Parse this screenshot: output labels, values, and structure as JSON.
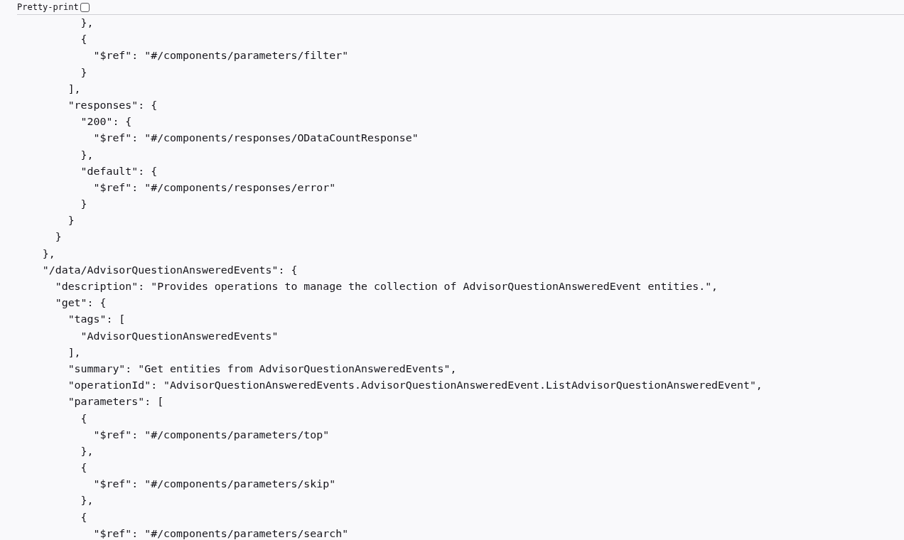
{
  "toolbar": {
    "label": "Pretty-print",
    "checked": false
  },
  "lines": [
    "            },",
    "            {",
    "              \"$ref\": \"#/components/parameters/filter\"",
    "            }",
    "          ],",
    "          \"responses\": {",
    "            \"200\": {",
    "              \"$ref\": \"#/components/responses/ODataCountResponse\"",
    "            },",
    "            \"default\": {",
    "              \"$ref\": \"#/components/responses/error\"",
    "            }",
    "          }",
    "        }",
    "      },",
    "      \"/data/AdvisorQuestionAnsweredEvents\": {",
    "        \"description\": \"Provides operations to manage the collection of AdvisorQuestionAnsweredEvent entities.\",",
    "        \"get\": {",
    "          \"tags\": [",
    "            \"AdvisorQuestionAnsweredEvents\"",
    "          ],",
    "          \"summary\": \"Get entities from AdvisorQuestionAnsweredEvents\",",
    "          \"operationId\": \"AdvisorQuestionAnsweredEvents.AdvisorQuestionAnsweredEvent.ListAdvisorQuestionAnsweredEvent\",",
    "          \"parameters\": [",
    "            {",
    "              \"$ref\": \"#/components/parameters/top\"",
    "            },",
    "            {",
    "              \"$ref\": \"#/components/parameters/skip\"",
    "            },",
    "            {",
    "              \"$ref\": \"#/components/parameters/search\""
  ]
}
